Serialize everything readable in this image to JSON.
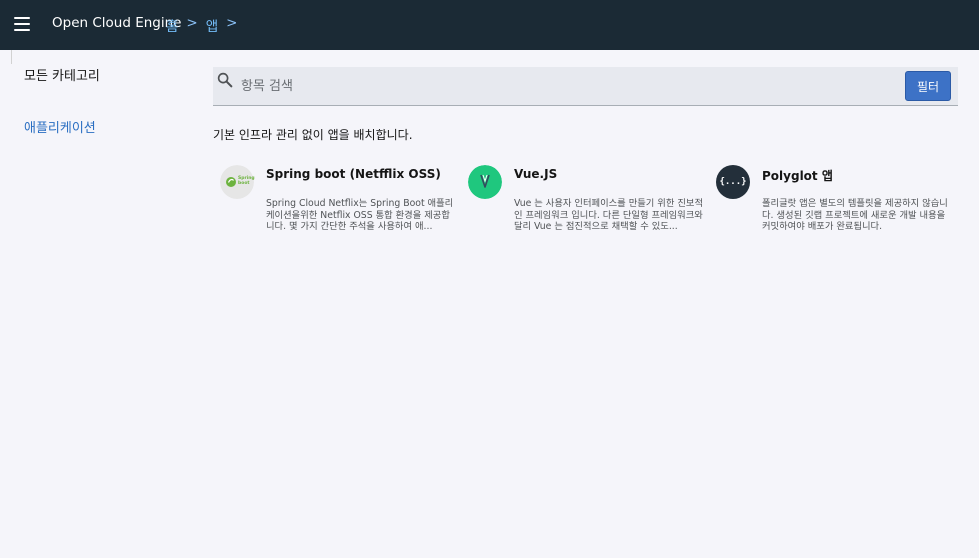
{
  "header": {
    "app_title": "Open Cloud Engine",
    "breadcrumb": [
      {
        "label": "홈"
      },
      {
        "label": ">"
      },
      {
        "label": "앱"
      },
      {
        "label": ">"
      }
    ]
  },
  "sidebar": {
    "heading": "모든 카테고리",
    "items": [
      {
        "label": "애플리케이션"
      }
    ]
  },
  "search": {
    "placeholder": "항목 검색",
    "value": "",
    "filter_label": "필터"
  },
  "main": {
    "description": "기본 인프라 관리 없이 앱을 배치합니다.",
    "cards": [
      {
        "title": "Spring boot (Netfflix OSS)",
        "description": "Spring Cloud Netflix는 Spring Boot 애플리케이션을위한 Netflix OSS 통합 환경을 제공합니다. 몇 가지 간단한 주석을 사용하여 애...",
        "icon": "spring-boot-icon",
        "icon_text": "Spring boot"
      },
      {
        "title": "Vue.JS",
        "description": "Vue 는 사용자 인터페이스를 만들기 위한 진보적인 프레임워크 입니다. 다른 단일형 프레임워크와 달리 Vue 는 점진적으로 채택할 수 있도...",
        "icon": "vue-icon"
      },
      {
        "title": "Polyglot 앱",
        "description": "폴리글랏 앱은 별도의 템플릿을 제공하지 않습니다. 생성된 깃랩 프로젝트에 새로운 개발 내용을 커밋하여야 배포가 완료됩니다.",
        "icon": "polyglot-icon",
        "icon_text": "{...}"
      }
    ]
  },
  "colors": {
    "header_bg": "#1b2a35",
    "accent": "#3d72c6",
    "link": "#2b6fc2",
    "page_bg": "#f5f5fa"
  }
}
